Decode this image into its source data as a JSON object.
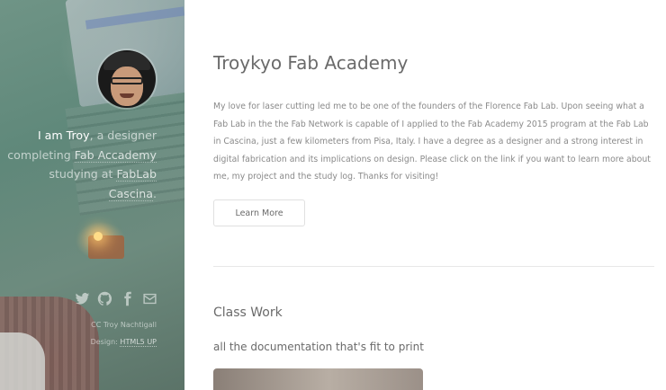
{
  "sidebar": {
    "intro": {
      "name": "I am Troy",
      "part1": ", a designer completing ",
      "academy_link": "Fab Accademy",
      "part2": " studying at ",
      "lab_link": "FabLab Cascina",
      "end": "."
    },
    "social_icons": [
      "twitter-icon",
      "github-icon",
      "facebook-icon",
      "mail-icon"
    ],
    "credit": "CC Troy Nachtigall",
    "design_label": "Design: ",
    "design_link": "HTML5 UP"
  },
  "main": {
    "title": "Troykyo Fab Academy",
    "intro_paragraph": "My love for laser cutting led me to be one of the founders of the Florence Fab Lab. Upon seeing what a Fab Lab in the the Fab Network is capable of I applied to the Fab Academy 2015 program at the Fab Lab in Cascina, just a few kilometers from Pisa, Italy. I have a degree as a designer and a strong interest in digital fabrication and its implications on design. Please click on the link if you want to learn more about me, my project and the study log. Thanks for visiting!",
    "button_label": "Learn More",
    "section_title": "Class Work",
    "section_subtitle": "all the documentation that's fit to print"
  }
}
